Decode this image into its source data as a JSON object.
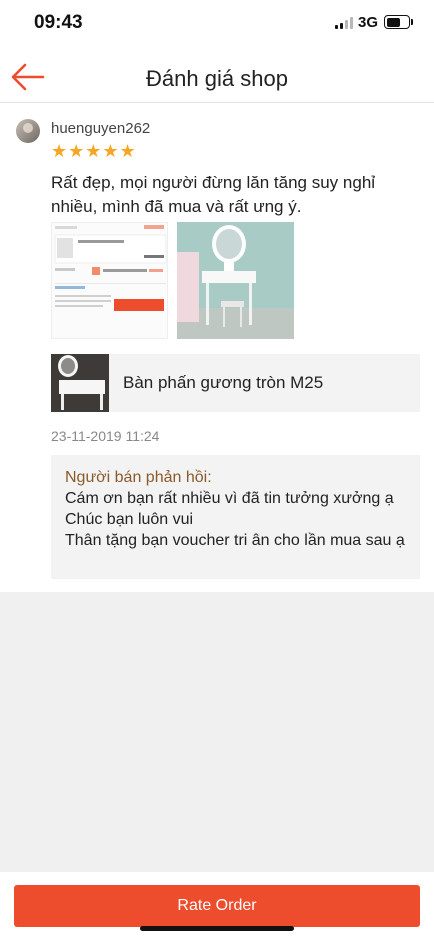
{
  "status_bar": {
    "time": "09:43",
    "network": "3G",
    "battery_level": 0.7
  },
  "header": {
    "title": "Đánh giá shop",
    "back_icon": "arrow-left-icon"
  },
  "review": {
    "username": "huenguyen262",
    "rating": 5,
    "stars": "★★★★★",
    "text": "Rất đẹp, mọi người đừng lăn tăng suy nghỉ nhiều, mình đã mua và rất ưng ý.",
    "date": "23-11-2019 11:24",
    "product": {
      "name": "Bàn phấn gương tròn M25"
    },
    "seller_reply": {
      "label": "Người bán phản hồi:",
      "text": "Cám ơn bạn rất nhiều vì đã tin tưởng xưởng ạ\nChúc bạn luôn vui\nThân tặng bạn voucher tri ân cho lần mua sau ạ"
    }
  },
  "footer": {
    "rate_button": "Rate Order"
  },
  "colors": {
    "accent": "#ee4d2d",
    "star": "#f6a623",
    "reply_label": "#8b5a2b"
  }
}
